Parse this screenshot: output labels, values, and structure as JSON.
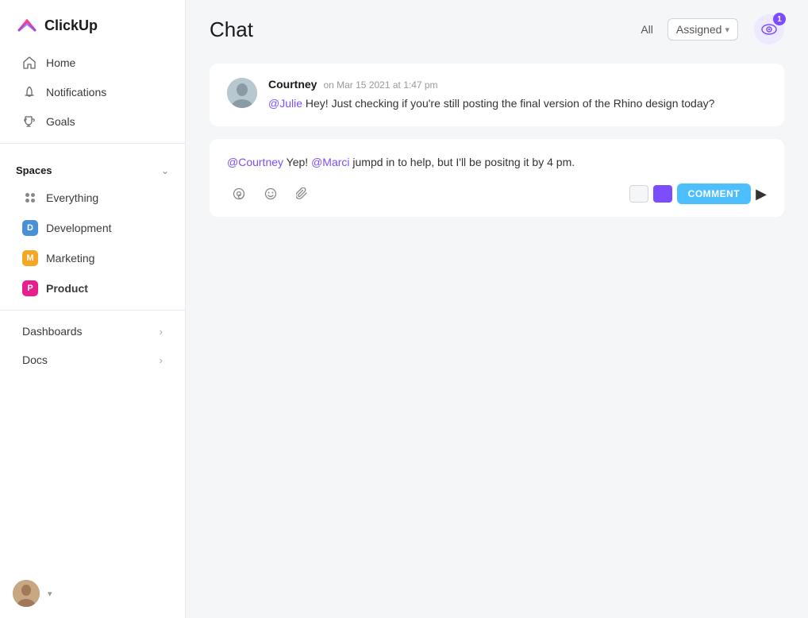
{
  "app": {
    "name": "ClickUp"
  },
  "sidebar": {
    "nav": [
      {
        "id": "home",
        "label": "Home",
        "icon": "home-icon"
      },
      {
        "id": "notifications",
        "label": "Notifications",
        "icon": "bell-icon"
      },
      {
        "id": "goals",
        "label": "Goals",
        "icon": "trophy-icon"
      }
    ],
    "spaces_label": "Spaces",
    "spaces": [
      {
        "id": "everything",
        "label": "Everything",
        "type": "dots"
      },
      {
        "id": "development",
        "label": "Development",
        "type": "badge",
        "color": "#4a90d9",
        "letter": "D"
      },
      {
        "id": "marketing",
        "label": "Marketing",
        "type": "badge",
        "color": "#f5a623",
        "letter": "M"
      },
      {
        "id": "product",
        "label": "Product",
        "type": "badge",
        "color": "#e91e8c",
        "letter": "P",
        "active": true
      }
    ],
    "bottom": [
      {
        "id": "dashboards",
        "label": "Dashboards"
      },
      {
        "id": "docs",
        "label": "Docs"
      }
    ]
  },
  "chat": {
    "title": "Chat",
    "filter_all": "All",
    "filter_assigned": "Assigned",
    "watch_count": "1",
    "messages": [
      {
        "id": "msg1",
        "author": "Courtney",
        "time": "on Mar 15 2021 at 1:47 pm",
        "mention": "@Julie",
        "text": " Hey! Just checking if you're still posting the final version of the Rhino design today?"
      }
    ],
    "reply": {
      "mention1": "@Courtney",
      "text1": " Yep! ",
      "mention2": "@Marci",
      "text2": " jumpd in to help, but I'll be positng it by 4 pm."
    },
    "comment_button": "COMMENT"
  }
}
